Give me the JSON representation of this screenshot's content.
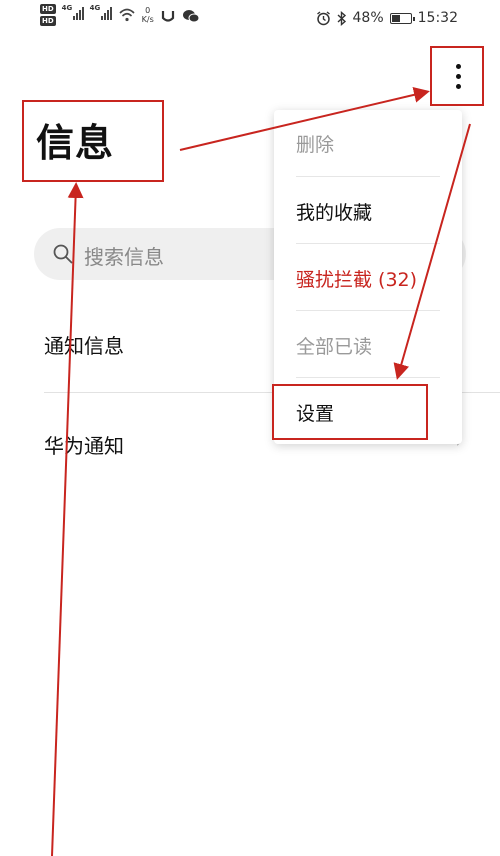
{
  "status_bar": {
    "hd1": "HD",
    "hd2": "HD",
    "net1": "4G",
    "net2": "4G",
    "speed_value": "0",
    "speed_unit": "K/s",
    "battery_percent": "48%",
    "battery_level": 0.48,
    "time": "15:32"
  },
  "page": {
    "title": "信息"
  },
  "search": {
    "placeholder": "搜索信息"
  },
  "conversations": [
    {
      "name": "通知信息"
    },
    {
      "name": "华为通知"
    }
  ],
  "menu": {
    "items": [
      {
        "label": "删除",
        "state": "disabled",
        "color": "#9a9a9a"
      },
      {
        "label": "我的收藏",
        "state": "normal",
        "color": "#111111"
      },
      {
        "label": "骚扰拦截 (32)",
        "state": "highlight",
        "color": "#c8251f"
      },
      {
        "label": "全部已读",
        "state": "disabled",
        "color": "#9a9a9a"
      },
      {
        "label": "设置",
        "state": "normal",
        "color": "#111111"
      }
    ]
  },
  "colors": {
    "annotation": "#c8251f",
    "search_bg": "#efefef"
  },
  "icons": {
    "more": "more-vertical-icon",
    "search": "search-icon",
    "alarm": "alarm-icon",
    "bluetooth": "bluetooth-icon",
    "wifi": "wifi-icon",
    "wechat": "wechat-icon"
  }
}
